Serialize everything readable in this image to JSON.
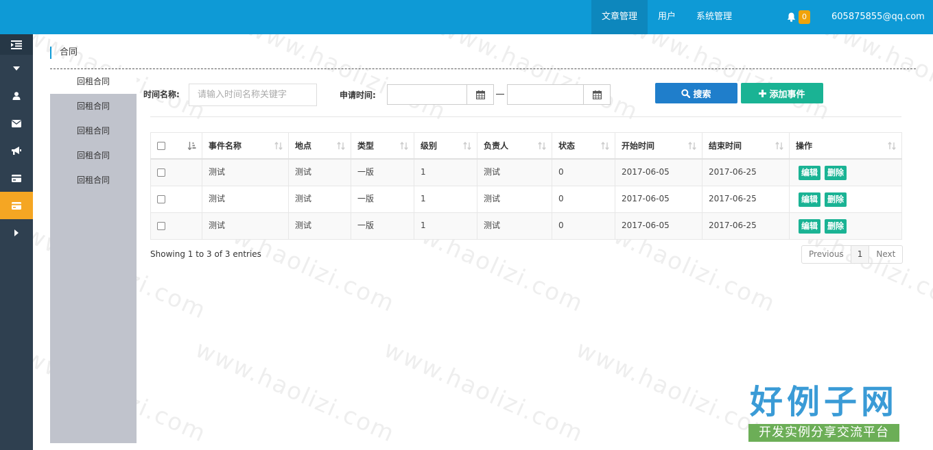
{
  "topbar": {
    "nav": [
      {
        "label": "文章管理",
        "active": true
      },
      {
        "label": "用户",
        "active": false
      },
      {
        "label": "系统管理",
        "active": false
      }
    ],
    "notification_count": "0",
    "user_email": "605875855@qq.com"
  },
  "sidebar": {
    "items": [
      {
        "icon": "indent-icon"
      },
      {
        "icon": "caret-down-icon"
      },
      {
        "icon": "user-icon"
      },
      {
        "icon": "envelope-icon"
      },
      {
        "icon": "bullhorn-icon"
      },
      {
        "icon": "credit-card-icon"
      },
      {
        "icon": "credit-card-icon",
        "active": true
      },
      {
        "icon": "caret-right-icon"
      }
    ]
  },
  "breadcrumb": "合同",
  "submenu": {
    "items": [
      "回租合同",
      "回租合同",
      "回租合同",
      "回租合同",
      "回租合同"
    ]
  },
  "filter": {
    "name_label": "时间名称:",
    "name_placeholder": "请输入时间名称关键字",
    "date_label": "申请时间:",
    "search_label": "搜索",
    "add_label": "添加事件"
  },
  "table": {
    "columns": [
      "事件名称",
      "地点",
      "类型",
      "级别",
      "负责人",
      "状态",
      "开始时间",
      "结束时间",
      "操作"
    ],
    "rows": [
      [
        "测试",
        "测试",
        "一版",
        "1",
        "测试",
        "0",
        "2017-06-05",
        "2017-06-25"
      ],
      [
        "测试",
        "测试",
        "一版",
        "1",
        "测试",
        "0",
        "2017-06-05",
        "2017-06-25"
      ],
      [
        "测试",
        "测试",
        "一版",
        "1",
        "测试",
        "0",
        "2017-06-05",
        "2017-06-25"
      ]
    ],
    "edit_label": "编辑",
    "delete_label": "删除",
    "info": "Showing 1 to 3 of 3 entries",
    "pager": {
      "previous": "Previous",
      "page": "1",
      "next": "Next"
    }
  },
  "watermark": {
    "text": "www.haolizi.com",
    "logo_title": "好例子网",
    "logo_subtitle": "开发实例分享交流平台"
  },
  "colors": {
    "topbar": "#0e9ad6",
    "sidebar": "#2f4050",
    "sidebar_active": "#f5a623",
    "primary_button": "#1f7ecb",
    "success_button": "#1ab394"
  }
}
